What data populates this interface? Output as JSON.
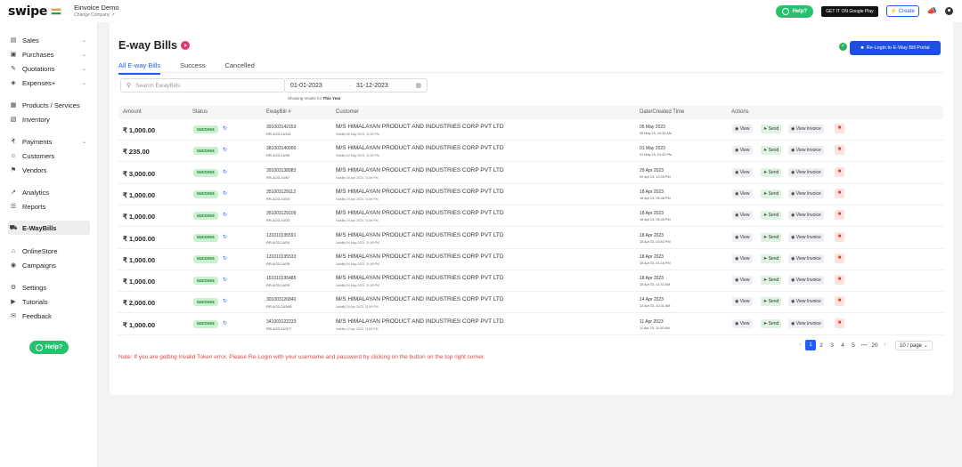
{
  "header": {
    "logo_text": "swipe",
    "company_name": "Einvoice Demo",
    "change_company": "Change Company ↗",
    "help_label": "Help?",
    "google_play_label": "GET IT ON Google Play",
    "create_label": "Create"
  },
  "sidebar": {
    "items": [
      {
        "label": "Sales",
        "icon": "wallet-icon",
        "glyph": "▤",
        "chevron": true
      },
      {
        "label": "Purchases",
        "icon": "cart-icon",
        "glyph": "▣",
        "chevron": true
      },
      {
        "label": "Quotations",
        "icon": "pen-icon",
        "glyph": "✎",
        "chevron": true
      },
      {
        "label": "Expenses+",
        "icon": "tag-icon",
        "glyph": "◈",
        "chevron": true
      },
      {
        "label": "Products / Services",
        "icon": "products-icon",
        "glyph": "▦",
        "chevron": false
      },
      {
        "label": "Inventory",
        "icon": "inventory-icon",
        "glyph": "▧",
        "chevron": false
      },
      {
        "label": "Payments",
        "icon": "rupee-icon",
        "glyph": "₹",
        "chevron": true
      },
      {
        "label": "Customers",
        "icon": "customer-icon",
        "glyph": "☺",
        "chevron": false
      },
      {
        "label": "Vendors",
        "icon": "vendor-icon",
        "glyph": "⚑",
        "chevron": false
      },
      {
        "label": "Analytics",
        "icon": "analytics-icon",
        "glyph": "↗",
        "chevron": false
      },
      {
        "label": "Reports",
        "icon": "reports-icon",
        "glyph": "☰",
        "chevron": false
      },
      {
        "label": "E-WayBills",
        "icon": "truck-icon",
        "glyph": "⛟",
        "chevron": false,
        "active": true
      },
      {
        "label": "OnlineStore",
        "icon": "store-icon",
        "glyph": "⌂",
        "chevron": false
      },
      {
        "label": "Campaigns",
        "icon": "campaign-icon",
        "glyph": "◉",
        "chevron": false
      },
      {
        "label": "Settings",
        "icon": "gear-icon",
        "glyph": "⚙",
        "chevron": false
      },
      {
        "label": "Tutorials",
        "icon": "tutorial-icon",
        "glyph": "▶",
        "chevron": false
      },
      {
        "label": "Feedback",
        "icon": "feedback-icon",
        "glyph": "✉",
        "chevron": false
      }
    ],
    "help_label": "Help?"
  },
  "main": {
    "title": "E-way Bills",
    "tabs": [
      {
        "label": "All E-way Bills",
        "active": true
      },
      {
        "label": "Success",
        "active": false
      },
      {
        "label": "Cancelled",
        "active": false
      }
    ],
    "relogin_label": "Re-Login to E-Way Bill Portal",
    "search_placeholder": "Search EwayBills",
    "date_from": "01-01-2023",
    "date_to": "31-12-2023",
    "showing_prefix": "Showing results for ",
    "showing_period": "This Year",
    "columns": {
      "amount": "Amount",
      "status": "Status",
      "ewaybill": "EwayBill #",
      "customer": "Customer",
      "date": "Date/Created Time",
      "actions": "Actions"
    },
    "actions": {
      "view": "View",
      "send": "Send",
      "invoice": "View Invoice"
    },
    "rows": [
      {
        "amount": "₹ 1,000.00",
        "status": "success",
        "ewaybill": "391003142153",
        "ref": "RR-4/23-24/111",
        "customer": "M/S HIMALAYAN PRODUCT AND INDUSTRIES CORP PVT LTD",
        "validity": "Validity:06 May 2023, 11:59 PM",
        "date": "05 May 2023",
        "time": "05 May 23, 10:32 AM"
      },
      {
        "amount": "₹ 235.00",
        "status": "success",
        "ewaybill": "381003140000",
        "ref": "RR-4/23-24/99",
        "customer": "M/S HIMALAYAN PRODUCT AND INDUSTRIES CORP PVT LTD",
        "validity": "Validity:02 May 2023, 11:59 PM",
        "date": "01 May 2023",
        "time": "01 May 23, 01:42 PM"
      },
      {
        "amount": "₹ 3,000.00",
        "status": "success",
        "ewaybill": "391003138983",
        "ref": "RR-4/23-24/87",
        "customer": "M/S HIMALAYAN PRODUCT AND INDUSTRIES CORP PVT LTD",
        "validity": "Validity:30 Apr 2023, 11:59 PM",
        "date": "29 Apr 2023",
        "time": "29 Apr 23, 12:05 PM"
      },
      {
        "amount": "₹ 1,000.00",
        "status": "success",
        "ewaybill": "351003129112",
        "ref": "RR-4/23-24/24",
        "customer": "M/S HIMALAYAN PRODUCT AND INDUSTRIES CORP PVT LTD",
        "validity": "Validity:19 Apr 2023, 11:59 PM",
        "date": "18 Apr 2023",
        "time": "18 Apr 23, 05:48 PM"
      },
      {
        "amount": "₹ 1,000.00",
        "status": "success",
        "ewaybill": "351003129109",
        "ref": "RR-4/23-24/23",
        "customer": "M/S HIMALAYAN PRODUCT AND INDUSTRIES CORP PVT LTD",
        "validity": "Validity:19 Apr 2023, 11:59 PM",
        "date": "18 Apr 2023",
        "time": "18 Apr 23, 05:45 PM"
      },
      {
        "amount": "₹ 1,000.00",
        "status": "success",
        "ewaybill": "131010135591",
        "ref": "RR-4/23-24/24",
        "customer": "M/S HIMALAYAN PRODUCT AND INDUSTRIES CORP PVT LTD",
        "validity": "Validity:04 May 2023, 11:59 PM",
        "date": "18 Apr 2023",
        "time": "18 Apr 23, 03:52 PM"
      },
      {
        "amount": "₹ 1,000.00",
        "status": "success",
        "ewaybill": "131010135533",
        "ref": "RR-4/23-24/25",
        "customer": "M/S HIMALAYAN PRODUCT AND INDUSTRIES CORP PVT LTD",
        "validity": "Validity:04 May 2023, 11:59 PM",
        "date": "18 Apr 2023",
        "time": "18 Apr 23, 01:18 PM"
      },
      {
        "amount": "₹ 1,000.00",
        "status": "success",
        "ewaybill": "151010135485",
        "ref": "RR-4/23-24/20",
        "customer": "M/S HIMALAYAN PRODUCT AND INDUSTRIES CORP PVT LTD",
        "validity": "Validity:04 May 2023, 11:59 PM",
        "date": "18 Apr 2023",
        "time": "18 Apr 23, 11:32 AM"
      },
      {
        "amount": "₹ 2,000.00",
        "status": "success",
        "ewaybill": "301003126840",
        "ref": "RR-4/23-24/008",
        "customer": "M/S HIMALAYAN PRODUCT AND INDUSTRIES CORP PVT LTD",
        "validity": "Validity:15 Apr 2023, 11:59 PM",
        "date": "14 Apr 2023",
        "time": "14 Apr 23, 10:31 AM"
      },
      {
        "amount": "₹ 1,000.00",
        "status": "success",
        "ewaybill": "341003122233",
        "ref": "RR-4/23-24/377",
        "customer": "M/S HIMALAYAN PRODUCT AND INDUSTRIES CORP PVT LTD",
        "validity": "Validity:12 Apr 2023, 11:59 PM",
        "date": "11 Apr 2023",
        "time": "11 Apr 23, 11:00 AM"
      }
    ],
    "pagination": {
      "pages": [
        "1",
        "2",
        "3",
        "4",
        "5"
      ],
      "ellipsis": "•••",
      "last": "20",
      "active": "1",
      "per_page": "10 / page"
    },
    "note": "Note: If you are getting Invalid Token error, Please Re-Login with your username and password by clicking on the button on the top right corner."
  }
}
